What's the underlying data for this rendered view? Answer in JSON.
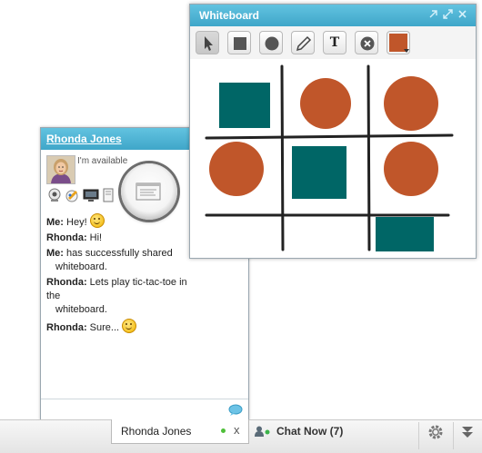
{
  "chat": {
    "contact_name": "Rhonda Jones",
    "status": "I'm available",
    "messages": [
      {
        "sender": "Me:",
        "text": "Hey!",
        "emoji": "smile-emoji"
      },
      {
        "sender": "Rhonda:",
        "text": "Hi!"
      },
      {
        "sender": "Me:",
        "text": "has successfully shared",
        "cont": "whiteboard."
      },
      {
        "sender": "Rhonda:",
        "text": "Lets play tic-tac-toe in the",
        "cont": "whiteboard."
      },
      {
        "sender": "Rhonda:",
        "text": "Sure...",
        "emoji": "smile-emoji"
      }
    ],
    "toolbar_icons": [
      "webcam-icon",
      "paint-icon",
      "screen-share-icon",
      "file-transfer-icon",
      "whiteboard-icon",
      "pencil-icon"
    ]
  },
  "whiteboard": {
    "title": "Whiteboard",
    "controls": [
      "popout-icon",
      "maximize-icon",
      "close-icon"
    ],
    "tools": [
      "pointer-tool",
      "rectangle-tool",
      "circle-tool",
      "pencil-tool",
      "text-tool",
      "clear-tool",
      "color-picker"
    ],
    "text_tool_label": "T",
    "current_color": "#c0562a",
    "board": {
      "cells": [
        [
          "square",
          "circle",
          "circle"
        ],
        [
          "circle",
          "square",
          "circle"
        ],
        [
          "",
          "",
          "square"
        ]
      ],
      "square_color": "#006666",
      "circle_color": "#c0562a"
    }
  },
  "bottombar": {
    "tab_name": "Rhonda Jones",
    "tab_close": "x",
    "chat_now_label": "Chat Now (7)"
  }
}
